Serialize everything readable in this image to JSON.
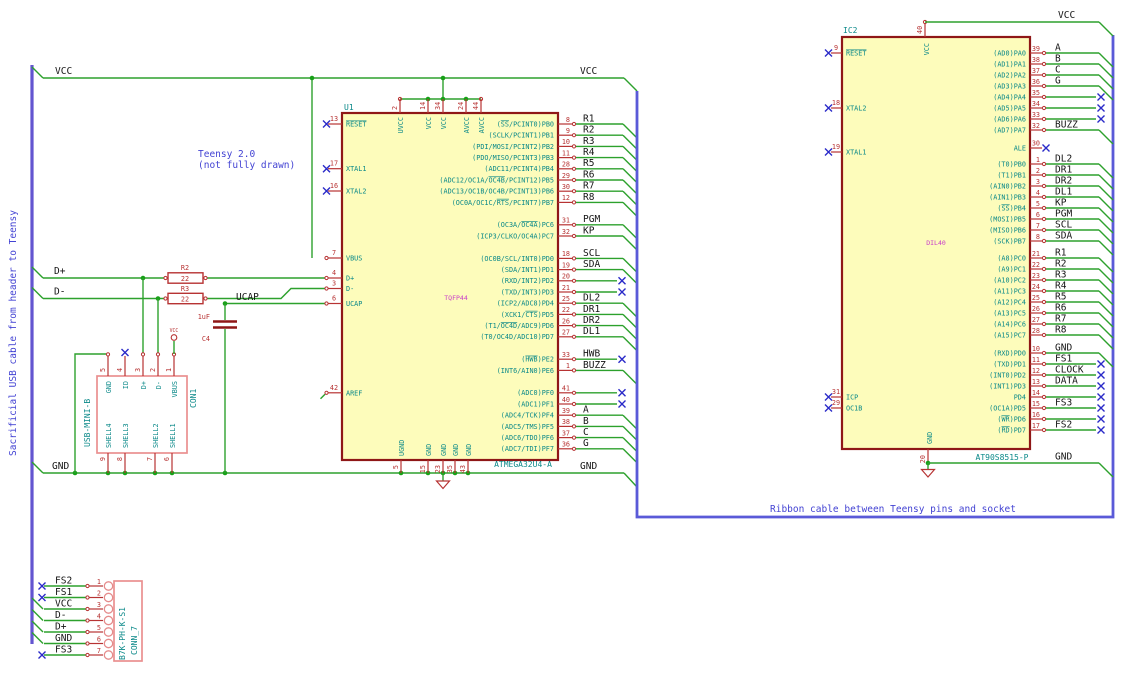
{
  "colors": {
    "wire_green": "#2da12d",
    "bus_blue": "#5a5ad8",
    "chip_fill": "#fdfcbb",
    "chip_border": "#8f1717",
    "pin_red": "#b73333",
    "name_teal": "#0b8989",
    "note_blue": "#4343d3",
    "nc_blue": "#2a2ac8",
    "footprint_magenta": "#c83cc8"
  },
  "notes": {
    "teensy_line1": "Teensy 2.0",
    "teensy_line2": "(not fully drawn)",
    "ribbon": "Ribbon cable between Teensy pins and socket",
    "usb_cable": "Sacrificial USB cable from header to Teensy"
  },
  "nets": {
    "vcc": "VCC",
    "gnd": "GND",
    "dp": "D+",
    "dm": "D-",
    "ucap": "UCAP"
  },
  "u1": {
    "ref": "U1",
    "value": "ATMEGA32U4-A",
    "footprint": "TQFP44",
    "right_pins": [
      {
        "row": 0,
        "num": "8",
        "name": "(~SS~/PCINT0)PB0",
        "label": "R1"
      },
      {
        "row": 1,
        "num": "9",
        "name": "(SCLK/PCINT1)PB1",
        "label": "R2"
      },
      {
        "row": 2,
        "num": "10",
        "name": "(PDI/MOSI/PCINT2)PB2",
        "label": "R3"
      },
      {
        "row": 3,
        "num": "11",
        "name": "(PDO/MISO/PCINT3)PB3",
        "label": "R4"
      },
      {
        "row": 4,
        "num": "28",
        "name": "(ADC11/PCINT4)PB4",
        "label": "R5"
      },
      {
        "row": 5,
        "num": "29",
        "name": "(ADC12/OC1A/~OC4B~/PCINT12)PB5",
        "label": "R6"
      },
      {
        "row": 6,
        "num": "30",
        "name": "(ADC13/OC1B/OC4B/PCINT13)PB6",
        "label": "R7"
      },
      {
        "row": 7,
        "num": "12",
        "name": "(OC0A/OC1C/~RTS~/PCINT7)PB7",
        "label": "R8"
      },
      {
        "row": 9,
        "num": "31",
        "name": "(OC3A/~OC4A~)PC6",
        "label": "PGM"
      },
      {
        "row": 10,
        "num": "32",
        "name": "(ICP3/CLKO/OC4A)PC7",
        "label": "KP"
      },
      {
        "row": 12,
        "num": "18",
        "name": "(OC0B/SCL/INT0)PD0",
        "label": "SCL"
      },
      {
        "row": 13,
        "num": "19",
        "name": "(SDA/INT1)PD1",
        "label": "SDA"
      },
      {
        "row": 14,
        "num": "20",
        "name": "(RXD/INT2)PD2",
        "nc": true
      },
      {
        "row": 15,
        "num": "21",
        "name": "(TXD/INT3)PD3",
        "nc": true
      },
      {
        "row": 16,
        "num": "25",
        "name": "(ICP2/ADC8)PD4",
        "label": "DL2"
      },
      {
        "row": 17,
        "num": "22",
        "name": "(XCK1/~CTS~)PD5",
        "label": "DR1"
      },
      {
        "row": 18,
        "num": "26",
        "name": "(T1/~OC4D~/ADC9)PD6",
        "label": "DR2"
      },
      {
        "row": 19,
        "num": "27",
        "name": "(T0/OC4D/ADC10)PD7",
        "label": "DL1"
      },
      {
        "row": 21,
        "num": "33",
        "name": "(~HWB~)PE2",
        "label": "HWB",
        "nc": true
      },
      {
        "row": 22,
        "num": "1",
        "name": "(INT6/AIN0)PE6",
        "label": "BUZZ"
      },
      {
        "row": 24,
        "num": "41",
        "name": "(ADC0)PF0",
        "nc": true
      },
      {
        "row": 25,
        "num": "40",
        "name": "(ADC1)PF1",
        "nc": true
      },
      {
        "row": 26,
        "num": "39",
        "name": "(ADC4/TCK)PF4",
        "label": "A"
      },
      {
        "row": 27,
        "num": "38",
        "name": "(ADC5/TMS)PF5",
        "label": "B"
      },
      {
        "row": 28,
        "num": "37",
        "name": "(ADC6/TDO)PF6",
        "label": "C"
      },
      {
        "row": 29,
        "num": "36",
        "name": "(ADC7/TDI)PF7",
        "label": "G"
      }
    ],
    "left_pins": [
      {
        "num": "13",
        "name": "~RESET~"
      },
      {
        "num": "17",
        "name": "XTAL1"
      },
      {
        "num": "16",
        "name": "XTAL2"
      },
      {
        "num": "7",
        "name": "VBUS"
      },
      {
        "num": "4",
        "name": "D+"
      },
      {
        "num": "3",
        "name": "D-"
      },
      {
        "num": "6",
        "name": "UCAP"
      },
      {
        "num": "42",
        "name": "AREF"
      }
    ],
    "top_pins": [
      {
        "num": "2",
        "name": "UVCC"
      },
      {
        "num": "14",
        "name": "VCC"
      },
      {
        "num": "34",
        "name": "VCC"
      },
      {
        "num": "24",
        "name": "AVCC"
      },
      {
        "num": "44",
        "name": "AVCC"
      }
    ],
    "bottom_pins": [
      {
        "num": "5",
        "name": "UGND"
      },
      {
        "num": "15",
        "name": "GND"
      },
      {
        "num": "23",
        "name": "GND"
      },
      {
        "num": "35",
        "name": "GND"
      },
      {
        "num": "43",
        "name": "GND"
      }
    ]
  },
  "ic2": {
    "ref": "IC2",
    "value": "AT90S8515-P",
    "footprint": "DIL40",
    "pa_pins": [
      {
        "num": "39",
        "name": "(AD0)PA0",
        "label": "A"
      },
      {
        "num": "38",
        "name": "(AD1)PA1",
        "label": "B"
      },
      {
        "num": "37",
        "name": "(AD2)PA2",
        "label": "C"
      },
      {
        "num": "36",
        "name": "(AD3)PA3",
        "label": "G"
      },
      {
        "num": "35",
        "name": "(AD4)PA4",
        "nc": true
      },
      {
        "num": "34",
        "name": "(AD5)PA5",
        "nc": true
      },
      {
        "num": "33",
        "name": "(AD6)PA6",
        "nc": true
      },
      {
        "num": "32",
        "name": "(AD7)PA7",
        "label": "BUZZ"
      }
    ],
    "ale_pin": {
      "num": "30",
      "name": "ALE"
    },
    "pb_pins": [
      {
        "num": "1",
        "name": "(T0)PB0",
        "label": "DL2"
      },
      {
        "num": "2",
        "name": "(T1)PB1",
        "label": "DR1"
      },
      {
        "num": "3",
        "name": "(AIN0)PB2",
        "label": "DR2"
      },
      {
        "num": "4",
        "name": "(AIN1)PB3",
        "label": "DL1"
      },
      {
        "num": "5",
        "name": "(~SS~)PB4",
        "label": "KP"
      },
      {
        "num": "6",
        "name": "(MOSI)PB5",
        "label": "PGM"
      },
      {
        "num": "7",
        "name": "(MISO)PB6",
        "label": "SCL"
      },
      {
        "num": "8",
        "name": "(SCK)PB7",
        "label": "SDA"
      }
    ],
    "pc_pins": [
      {
        "num": "21",
        "name": "(A8)PC0",
        "label": "R1"
      },
      {
        "num": "22",
        "name": "(A9)PC1",
        "label": "R2"
      },
      {
        "num": "23",
        "name": "(A10)PC2",
        "label": "R3"
      },
      {
        "num": "24",
        "name": "(A11)PC3",
        "label": "R4"
      },
      {
        "num": "25",
        "name": "(A12)PC4",
        "label": "R5"
      },
      {
        "num": "26",
        "name": "(A13)PC5",
        "label": "R6"
      },
      {
        "num": "27",
        "name": "(A14)PC6",
        "label": "R7"
      },
      {
        "num": "28",
        "name": "(A15)PC7",
        "label": "R8"
      }
    ],
    "pd_pins": [
      {
        "num": "10",
        "name": "(RXD)PD0",
        "label": "GND"
      },
      {
        "num": "11",
        "name": "(TXD)PD1",
        "label": "FS1",
        "nc": true
      },
      {
        "num": "12",
        "name": "(INT0)PD2",
        "label": "CLOCK",
        "nc": true
      },
      {
        "num": "13",
        "name": "(INT1)PD3",
        "label": "DATA",
        "nc": true
      },
      {
        "num": "14",
        "name": "PD4",
        "nc": true
      },
      {
        "num": "15",
        "name": "(OC1A)PD5",
        "label": "FS3",
        "nc": true
      },
      {
        "num": "16",
        "name": "(~WR~)PD6",
        "nc": true
      },
      {
        "num": "17",
        "name": "(~RD~)PD7",
        "label": "FS2",
        "nc": true
      }
    ],
    "left_pins": [
      {
        "num": "9",
        "name": "~RESET~"
      },
      {
        "num": "18",
        "name": "XTAL2"
      },
      {
        "num": "19",
        "name": "XTAL1"
      },
      {
        "num": "31",
        "name": "ICP"
      },
      {
        "num": "29",
        "name": "OC1B"
      }
    ],
    "top_pin": {
      "num": "40",
      "name": "VCC"
    },
    "bottom_pin": {
      "num": "20",
      "name": "GND"
    }
  },
  "con1": {
    "ref": "CON1",
    "value": "USB-MINI-B",
    "top_pins": [
      {
        "num": "5",
        "name": "GND"
      },
      {
        "num": "4",
        "name": "ID"
      },
      {
        "num": "3",
        "name": "D+"
      },
      {
        "num": "2",
        "name": "D-"
      },
      {
        "num": "1",
        "name": "VBUS"
      }
    ],
    "bottom_pins": [
      {
        "num": "9",
        "name": "SHELL4"
      },
      {
        "num": "8",
        "name": "SHELL3"
      },
      {
        "num": "7",
        "name": "SHELL2"
      },
      {
        "num": "6",
        "name": "SHELL1"
      }
    ]
  },
  "conn7": {
    "ref": "CONN_7",
    "value": "B7K-PH-K-S1",
    "pins": [
      {
        "num": "1",
        "label": "FS2",
        "nc": true
      },
      {
        "num": "2",
        "label": "FS1",
        "nc": true
      },
      {
        "num": "3",
        "label": "VCC"
      },
      {
        "num": "4",
        "label": "D-"
      },
      {
        "num": "5",
        "label": "D+"
      },
      {
        "num": "6",
        "label": "GND"
      },
      {
        "num": "7",
        "label": "FS3",
        "nc": true
      }
    ]
  },
  "r2": {
    "ref": "R2",
    "value": "22"
  },
  "r3": {
    "ref": "R3",
    "value": "22"
  },
  "c4": {
    "ref": "C4",
    "value": "1uF"
  }
}
